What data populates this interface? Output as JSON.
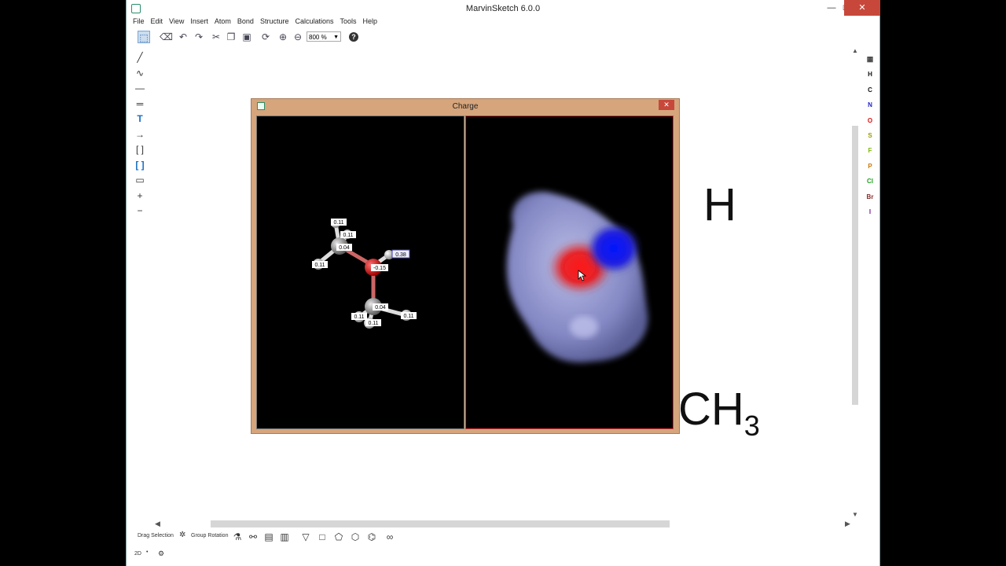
{
  "window": {
    "title": "MarvinSketch 6.0.0",
    "min": "—",
    "max": "☐",
    "close": "✕"
  },
  "menu": [
    "File",
    "Edit",
    "View",
    "Insert",
    "Atom",
    "Bond",
    "Structure",
    "Calculations",
    "Tools",
    "Help"
  ],
  "toolbar": {
    "zoom_value": "800 %"
  },
  "canvas": {
    "partial_h": "H",
    "partial_ch": "CH",
    "partial_sub": "3"
  },
  "elements": [
    {
      "sym": "H",
      "color": "#111111"
    },
    {
      "sym": "C",
      "color": "#111111"
    },
    {
      "sym": "N",
      "color": "#2222cc"
    },
    {
      "sym": "O",
      "color": "#dd1111"
    },
    {
      "sym": "S",
      "color": "#9a9a00"
    },
    {
      "sym": "F",
      "color": "#7ab800"
    },
    {
      "sym": "P",
      "color": "#c87800"
    },
    {
      "sym": "Cl",
      "color": "#1ea01e"
    },
    {
      "sym": "Br",
      "color": "#8a2a2a"
    },
    {
      "sym": "I",
      "color": "#7a1a9a"
    }
  ],
  "bottom": {
    "drag_selection": "Drag Selection",
    "group_rotation": "Group Rotation"
  },
  "status": {
    "mode": "2D"
  },
  "dialog": {
    "title": "Charge",
    "labels": [
      "0.11",
      "0.11",
      "0.04",
      "0.11",
      "-0.15",
      "0.38",
      "0.04",
      "0.11",
      "0.11",
      "0.11"
    ]
  }
}
